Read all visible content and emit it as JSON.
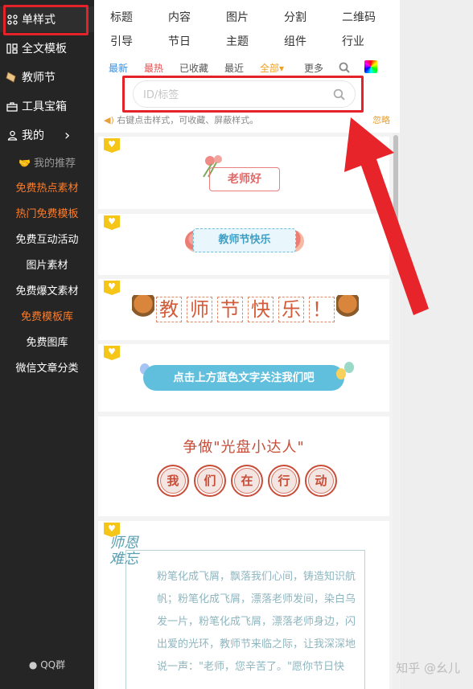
{
  "sidebar": {
    "items": [
      {
        "label": "单样式",
        "icon": "grid-icon"
      },
      {
        "label": "全文模板",
        "icon": "template-icon"
      },
      {
        "label": "教师节",
        "icon": "scroll-icon"
      },
      {
        "label": "工具宝箱",
        "icon": "toolbox-icon"
      },
      {
        "label": "我的",
        "icon": "user-icon",
        "arrow": "›"
      }
    ],
    "recommend_heading": "我的推荐",
    "sub_items": [
      "免费热点素材",
      "热门免费模板",
      "免费互动活动",
      "图片素材",
      "免费爆文素材",
      "免费模板库",
      "免费图库",
      "微信文章分类"
    ],
    "qq_label": "QQ群"
  },
  "categories": {
    "row1": [
      "标题",
      "内容",
      "图片",
      "分割",
      "二维码"
    ],
    "row2": [
      "引导",
      "节日",
      "主题",
      "组件",
      "行业"
    ]
  },
  "filters": [
    "最新",
    "最热",
    "已收藏",
    "最近",
    "全部",
    "更多"
  ],
  "filter_dropdown_arrow": "▾",
  "search": {
    "placeholder": "ID/标签"
  },
  "tip": "右键点击样式，可收藏、屏蔽样式。",
  "ignore_label": "忽略",
  "styles": {
    "teacher_button": "老师好",
    "teachers_day_ribbon": "教师节快乐",
    "big_chars": [
      "教",
      "师",
      "节",
      "快",
      "乐",
      "！"
    ],
    "follow_banner": "点击上方蓝色文字关注我们吧",
    "compete_title": "争做\"光盘小达人\"",
    "circle_chars": [
      "我",
      "们",
      "在",
      "行",
      "动"
    ],
    "calligraphy": "师恩难忘",
    "poem": "粉笔化成飞屑，飘落我们心间，铸造知识航帆；粉笔化成飞屑，漂落老师发间，染白乌发一片，粉笔化成飞屑，漂落老师身边，闪出爱的光环，教师节来临之际，让我深深地说一声：\"老师，您辛苦了。\"愿你节日快"
  },
  "watermark": "知乎 @幺儿",
  "colors": {
    "sidebar_bg": "#252525",
    "accent_orange": "#ff7d2a",
    "highlight_red": "#e3222a",
    "filter_blue": "#3b8fe0",
    "filter_red": "#e94f4f",
    "filter_gold": "#f0a020"
  }
}
